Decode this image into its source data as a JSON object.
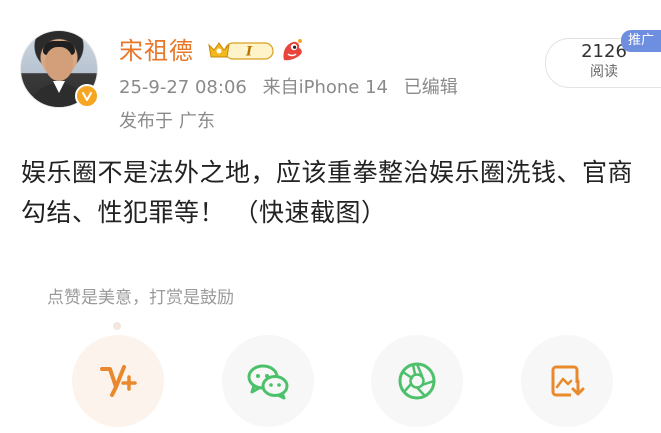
{
  "user": {
    "name": "宋祖德",
    "vip_level": "I",
    "timestamp": "25-9-27 08:06",
    "source": "来自iPhone 14",
    "edited": "已编辑",
    "location_prefix": "发布于",
    "location": "广东"
  },
  "stats": {
    "read_count": "2126",
    "read_label": "阅读",
    "promote_label": "推广"
  },
  "post": {
    "text": "娱乐圈不是法外之地，应该重拳整治娱乐圈洗钱、官商勾结、性犯罪等！ （快速截图）"
  },
  "reward": {
    "text": "点赞是美意，打赏是鼓励"
  },
  "actions": [
    {
      "icon": "vplus-icon",
      "color": "#e8892e"
    },
    {
      "icon": "wechat-icon",
      "color": "#4cc06a"
    },
    {
      "icon": "moments-icon",
      "color": "#4cc06a"
    },
    {
      "icon": "save-image-icon",
      "color": "#e8892e"
    }
  ],
  "colors": {
    "username": "#e8772a",
    "meta": "#8a8a8a",
    "promote": "#6e8fe0",
    "verify": "#f5a623"
  }
}
